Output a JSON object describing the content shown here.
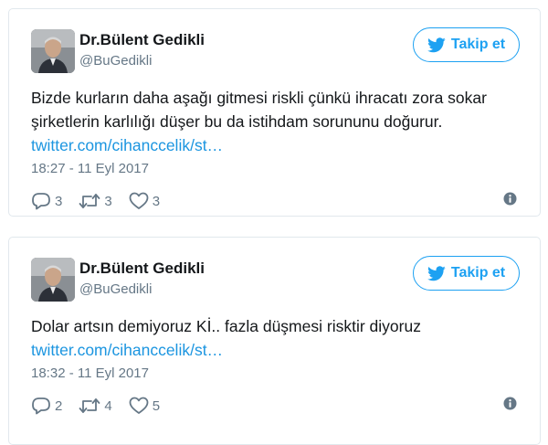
{
  "colors": {
    "brand": "#1da1f2",
    "link": "#1b95e0",
    "muted": "#657786",
    "text": "#14171a",
    "border": "#e1e8ed"
  },
  "tweets": [
    {
      "name": "Dr.Bülent Gedikli",
      "handle": "@BuGedikli",
      "follow_label": "Takip et",
      "text_lines": [
        "Bizde kurların daha aşağı gitmesi riskli çünkü ihracatı zora sokar",
        "şirketlerin karlılığı düşer bu da istihdam sorununu doğurur."
      ],
      "link": "twitter.com/cihanccelik/st…",
      "timestamp": "18:27 - 11 Eyl 2017",
      "replies": "3",
      "retweets": "3",
      "likes": "3",
      "icons": [
        "twitter-bird-icon",
        "reply-icon",
        "retweet-icon",
        "heart-icon",
        "info-icon"
      ]
    },
    {
      "name": "Dr.Bülent Gedikli",
      "handle": "@BuGedikli",
      "follow_label": "Takip et",
      "text_lines": [
        "Dolar artsın demiyoruz Kİ.. fazla düşmesi risktir diyoruz"
      ],
      "link": "twitter.com/cihanccelik/st…",
      "timestamp": "18:32 - 11 Eyl 2017",
      "replies": "2",
      "retweets": "4",
      "likes": "5",
      "icons": [
        "twitter-bird-icon",
        "reply-icon",
        "retweet-icon",
        "heart-icon",
        "info-icon"
      ]
    }
  ]
}
